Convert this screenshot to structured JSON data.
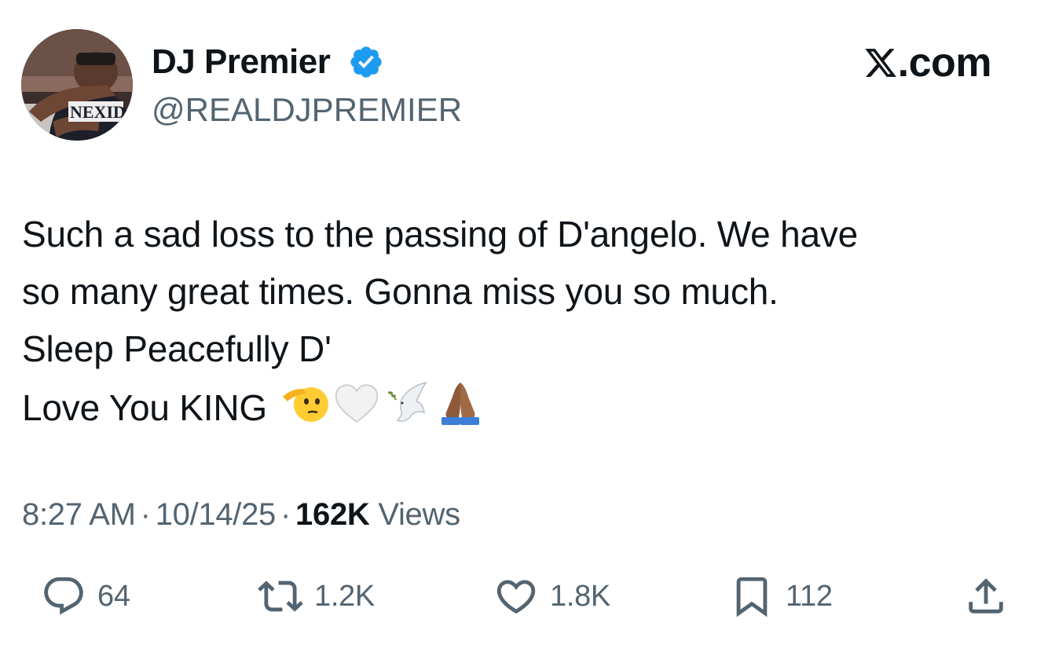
{
  "author": {
    "display_name": "DJ Premier",
    "handle": "@REALDJPREMIER",
    "avatar_shirt_text": "NEXID",
    "verified_color": "#1d9bf0"
  },
  "brand": {
    "label": ".com",
    "icon": "x-logo-icon"
  },
  "tweet": {
    "lines": [
      "Such a sad loss to the passing of D'angelo. We have",
      "so many great times. Gonna miss you so much.",
      "Sleep Peacefully D'",
      "Love You KING"
    ],
    "emojis": [
      "saluting-face-icon",
      "white-heart-icon",
      "dove-icon",
      "folded-hands-icon"
    ]
  },
  "meta": {
    "time": "8:27 AM",
    "sep": "·",
    "date": "10/14/25",
    "views_count": "162K",
    "views_label": "Views"
  },
  "actions": {
    "replies": "64",
    "reposts": "1.2K",
    "likes": "1.8K",
    "bookmarks": "112"
  },
  "colors": {
    "text": "#0f1419",
    "secondary": "#536471",
    "accent": "#1d9bf0"
  }
}
